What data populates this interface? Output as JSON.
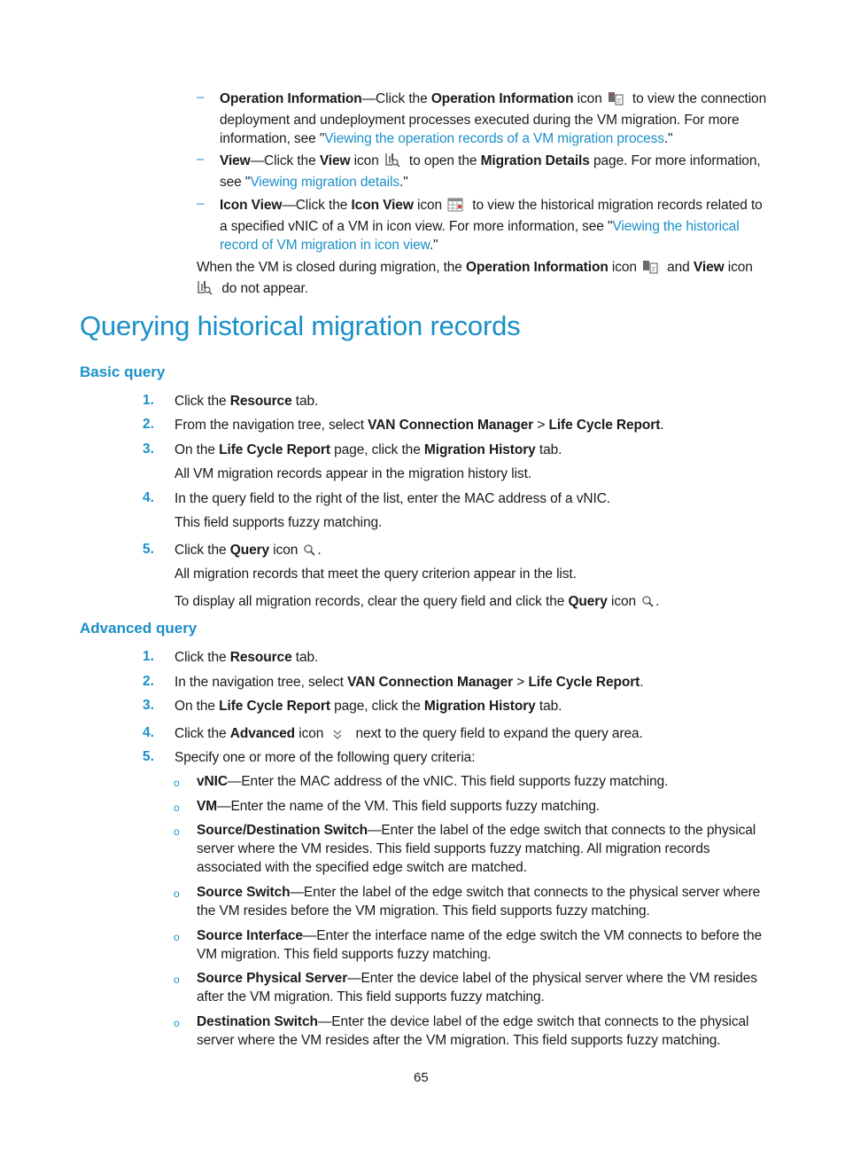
{
  "intro_items": [
    {
      "term": "Operation Information",
      "parts": [
        "—Click the ",
        "Operation Information",
        " icon",
        " to view the connection deployment and undeployment processes executed during the VM migration. For more information, see \"",
        "Viewing the operation records of a VM migration process",
        ".\""
      ],
      "icon": "operation-information-icon"
    },
    {
      "term": "View",
      "parts": [
        "—Click the ",
        "View",
        " icon",
        " to open the ",
        "Migration Details",
        " page. For more information, see \"",
        "Viewing migration details",
        ".\""
      ],
      "icon": "view-icon"
    },
    {
      "term": "Icon View",
      "parts": [
        "—Click the ",
        "Icon View",
        " icon",
        " to view the historical migration records related to a specified vNIC of a VM in icon view. For more information, see \"",
        "Viewing the historical record of VM migration in icon view",
        ".\""
      ],
      "icon": "icon-view-icon"
    }
  ],
  "note": {
    "pre": "When the VM is closed during migration, the ",
    "b1": "Operation Information",
    "mid1": " icon",
    "mid2": " and ",
    "b2": "View",
    "mid3": " icon",
    "post": " do not appear."
  },
  "heading": "Querying historical migration records",
  "basic": {
    "title": "Basic query",
    "steps": [
      {
        "n": "1.",
        "a": "Click the ",
        "b": "Resource",
        "c": " tab."
      },
      {
        "n": "2.",
        "a": "From the navigation tree, select ",
        "b": "VAN Connection Manager",
        "c": " > ",
        "d": "Life Cycle Report",
        "e": "."
      },
      {
        "n": "3.",
        "a": "On the ",
        "b": "Life Cycle Report",
        "c": " page, click the ",
        "d": "Migration History",
        "e": " tab.",
        "sub": "All VM migration records appear in the migration history list."
      },
      {
        "n": "4.",
        "a": "In the query field to the right of the list, enter the MAC address of a vNIC.",
        "sub": "This field supports fuzzy matching."
      },
      {
        "n": "5.",
        "a": "Click the ",
        "b": "Query",
        "c": " icon",
        "e": ".",
        "sub": "All migration records that meet the query criterion appear in the list.",
        "sub2a": "To display all migration records, clear the query field and click the ",
        "sub2b": "Query",
        "sub2c": " icon",
        "sub2d": "."
      }
    ]
  },
  "advanced": {
    "title": "Advanced query",
    "steps": [
      {
        "n": "1.",
        "a": "Click the ",
        "b": "Resource",
        "c": " tab."
      },
      {
        "n": "2.",
        "a": "In the navigation tree, select ",
        "b": "VAN Connection Manager",
        "c": " > ",
        "d": "Life Cycle Report",
        "e": "."
      },
      {
        "n": "3.",
        "a": "On the ",
        "b": "Life Cycle Report",
        "c": " page, click the ",
        "d": "Migration History",
        "e": " tab."
      },
      {
        "n": "4.",
        "a": "Click the ",
        "b": "Advanced",
        "c": " icon",
        "e": " next to the query field to expand the query area."
      },
      {
        "n": "5.",
        "a": "Specify one or more of the following query criteria:"
      }
    ],
    "criteria": [
      {
        "term": "vNIC",
        "desc": "—Enter the MAC address of the vNIC. This field supports fuzzy matching."
      },
      {
        "term": "VM",
        "desc": "—Enter the name of the VM. This field supports fuzzy matching."
      },
      {
        "term": "Source/Destination Switch",
        "desc": "—Enter the label of the edge switch that connects to the physical server where the VM resides. This field supports fuzzy matching. All migration records associated with the specified edge switch are matched."
      },
      {
        "term": "Source Switch",
        "desc": "—Enter the label of the edge switch that connects to the physical server where the VM resides before the VM migration. This field supports fuzzy matching."
      },
      {
        "term": "Source Interface",
        "desc": "—Enter the interface name of the edge switch the VM connects to before the VM migration. This field supports fuzzy matching."
      },
      {
        "term": "Source Physical Server",
        "desc": "—Enter the device label of the physical server where the VM resides after the VM migration. This field supports fuzzy matching."
      },
      {
        "term": "Destination Switch",
        "desc": "—Enter the device label of the edge switch that connects to the physical server where the VM resides after the VM migration. This field supports fuzzy matching."
      }
    ]
  },
  "page_number": "65"
}
